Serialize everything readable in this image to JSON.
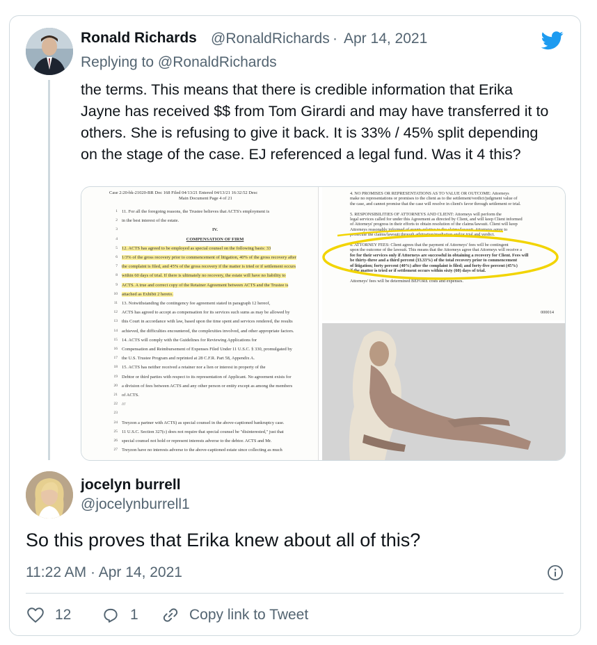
{
  "brand": {
    "accent": "#1d9bf0",
    "icon": "twitter-bird-icon"
  },
  "tweet": {
    "author_name": "Ronald Richards",
    "author_handle": "@RonaldRichards",
    "separator": "·",
    "date": "Apr 14, 2021",
    "replying_prefix": "Replying to",
    "replying_to": "@RonaldRichards",
    "text": "the terms. This means that there is credible information that Erika Jayne has received $$ from Tom Girardi and may have transferred it to others. She is refusing to give it back. It is 33% / 45% split depending on the stage of the case. EJ referenced a legal fund. Was it 4 this?",
    "media": {
      "left_doc": {
        "header": "Case 2:20-bk-21020-BR   Doc 168   Filed 04/13/21   Entered 04/13/21 16:32:52   Desc",
        "header2": "Main Document      Page 4 of 21",
        "lines": [
          {
            "no": "1",
            "text": "11.     For all the foregoing reasons, the Trustee believes that ACTS's employment is",
            "hl": false
          },
          {
            "no": "2",
            "text": "in the best interest of the estate.",
            "hl": false
          },
          {
            "no": "3",
            "text": "IV.",
            "hl": false
          },
          {
            "no": "4",
            "text": "COMPENSATION OF FIRM",
            "hl": false
          },
          {
            "no": "5",
            "text": "12.     ACTS has agreed to be employed as special counsel on the following basis: 33",
            "hl": true
          },
          {
            "no": "6",
            "text": "1/3% of the gross recovery prior to commencement of litigation, 40% of the gross recovery after",
            "hl": true
          },
          {
            "no": "7",
            "text": "the complaint is filed, and 45% of the gross recovery if the matter is tried or if settlement occurs",
            "hl": true
          },
          {
            "no": "8",
            "text": "within 60 days of trial.  If there is ultimately no recovery, the estate will have no liability to",
            "hl": true
          },
          {
            "no": "9",
            "text": "ACTS.  A true and correct copy of the Retainer Agreement between ACTS and the Trustee is",
            "hl": true
          },
          {
            "no": "10",
            "text": "attached as Exhibit 2 hereto.",
            "hl": true
          },
          {
            "no": "11",
            "text": "13.     Notwithstanding the contingency fee agreement stated in paragraph 12 hereof,",
            "hl": false
          },
          {
            "no": "12",
            "text": "ACTS has agreed to accept as compensation for its services such sums as may be allowed by",
            "hl": false
          },
          {
            "no": "13",
            "text": "this Court in accordance with law, based upon the time spent and services rendered, the results",
            "hl": false
          },
          {
            "no": "14",
            "text": "achieved, the difficulties encountered, the complexities involved, and other appropriate factors.",
            "hl": false
          },
          {
            "no": "15",
            "text": "14.     ACTS will comply with the Guidelines for Reviewing Applications for",
            "hl": false
          },
          {
            "no": "16",
            "text": "Compensation and Reimbursement of Expenses Filed Under 11 U.S.C. § 330, promulgated by",
            "hl": false
          },
          {
            "no": "17",
            "text": "the U.S. Trustee Program and reprinted at 28 C.F.R. Part 58, Appendix A.",
            "hl": false
          },
          {
            "no": "18",
            "text": "15.     ACTS has neither received a retainer nor a lien or interest in property of the",
            "hl": false
          },
          {
            "no": "19",
            "text": "Debtor or third parties with respect to its representation of Applicant.  No agreement exists for",
            "hl": false
          },
          {
            "no": "20",
            "text": "a division of fees between ACTS and any other person or entity except as among the members",
            "hl": false
          },
          {
            "no": "21",
            "text": "of ACTS.",
            "hl": false
          },
          {
            "no": "22",
            "text": "///",
            "hl": false
          },
          {
            "no": "23",
            "text": "",
            "hl": false
          },
          {
            "no": "24",
            "text": "Treyzon a partner with ACTS) as special counsel in the above-captioned bankruptcy case.",
            "hl": false
          },
          {
            "no": "25",
            "text": "11 U.S.C. Section 327(c) does not require that special counsel be \"disinterested,\" just that",
            "hl": false
          },
          {
            "no": "26",
            "text": "special counsel not hold or represent interests adverse to the debtor.  ACTS and Mr.",
            "hl": false
          },
          {
            "no": "27",
            "text": "Treyzon have no interests adverse to the above-captioned estate since collecting as much",
            "hl": false
          }
        ]
      },
      "right_doc": {
        "lines": [
          "4.     NO PROMISES OR REPRESENTATIONS AS TO VALUE OR OUTCOME: Attorneys",
          "make no representations or promises to the client as to the settlement/verdict/judgment value of",
          "the case, and cannot promise that the case will resolve in client's favor through settlement or trial.",
          "",
          "5.     RESPONSIBILITIES OF ATTORNEYS AND CLIENT: Attorneys will perform the",
          "legal services called for under this Agreement as directed by Client, and will keep Client informed",
          "of Attorneys' progress in their efforts to obtain resolution of the claims/lawsuit. Client will keep",
          "Attorneys reasonably informed of events relative to the claims/lawsuit. Attorneys agree to",
          "prosecute the claims/lawsuit through arbitration/mediation and/or trial and verdict.",
          "",
          "6.     ATTORNEY FEES: Client agrees that the payment of Attorneys' fees will be contingent",
          "upon the outcome of the lawsuit. This means that the Attorneys agree that Attorneys will receive a",
          "fee for their services only if Attorneys are successful in obtaining a recovery for Client.  Fees will",
          "be thirty-three and a third percent (33.33%) of the total recovery prior to commencement",
          "of litigation; forty percent (40%) after the complaint is filed; and forty-five percent (45%)",
          "if the matter is tried or if settlement occurs within sixty (60) days of trial.",
          "",
          "Attorneys' fees will be determined BEFORE costs and expenses."
        ],
        "page_no": "000014"
      }
    }
  },
  "reply": {
    "author_name": "jocelyn burrell",
    "author_handle": "@jocelynburrell1",
    "text": "So this proves that Erika knew about all of this?",
    "time": "11:22 AM",
    "separator": "·",
    "date": "Apr 14, 2021",
    "likes": "12",
    "replies": "1",
    "copy_link": "Copy link to Tweet"
  }
}
